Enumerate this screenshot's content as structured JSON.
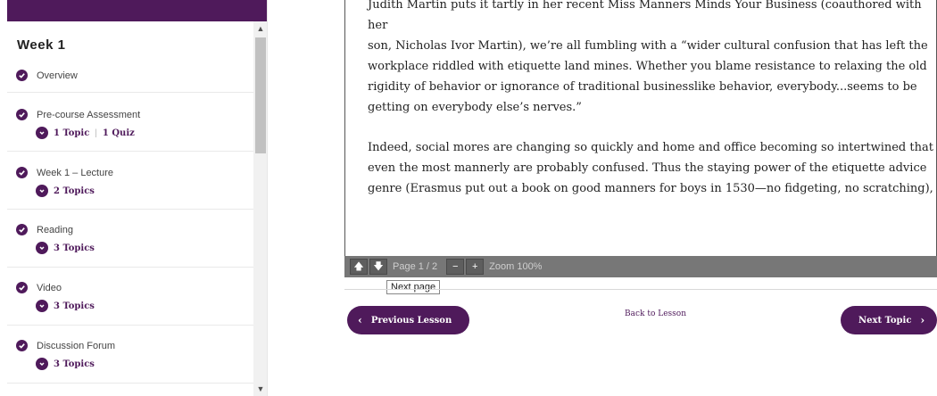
{
  "sidebar": {
    "week_title": "Week 1",
    "items": [
      {
        "label": "Overview"
      },
      {
        "label": "Pre-course Assessment",
        "sub": [
          "1 Topic",
          "1 Quiz"
        ]
      },
      {
        "label": "Week 1 – Lecture",
        "sub": [
          "2 Topics"
        ]
      },
      {
        "label": "Reading",
        "sub": [
          "3 Topics"
        ]
      },
      {
        "label": "Video",
        "sub": [
          "3 Topics"
        ]
      },
      {
        "label": "Discussion Forum",
        "sub": [
          "3 Topics"
        ]
      }
    ]
  },
  "document": {
    "para1_lines": [
      "Judith Martin puts it tartly in her recent Miss Manners Minds Your Business (coauthored with her",
      "son, Nicholas Ivor Martin), we’re all fumbling with a “wider cultural confusion that has left the",
      "workplace riddled with etiquette land mines. Whether you blame resistance to relaxing the old",
      "rigidity of behavior or ignorance of traditional businesslike behavior, everybody...seems to be",
      "getting on everybody else’s nerves.”"
    ],
    "para2_lines": [
      "Indeed, social mores are changing so quickly and home and office becoming so intertwined that",
      "even the most mannerly are probably confused. Thus the staying power of the etiquette advice",
      "genre (Erasmus put out a book on good manners for boys in 1530—no fidgeting, no scratching),"
    ]
  },
  "viewer": {
    "page_label": "Page 1 / 2",
    "zoom_label": "Zoom 100%",
    "minus": "−",
    "plus": "+",
    "tooltip": "Next page"
  },
  "nav": {
    "prev_label": "Previous Lesson",
    "back_label": "Back to Lesson",
    "next_label": "Next Topic"
  },
  "colors": {
    "brand": "#4f1a5b",
    "toolbar": "#777777"
  }
}
